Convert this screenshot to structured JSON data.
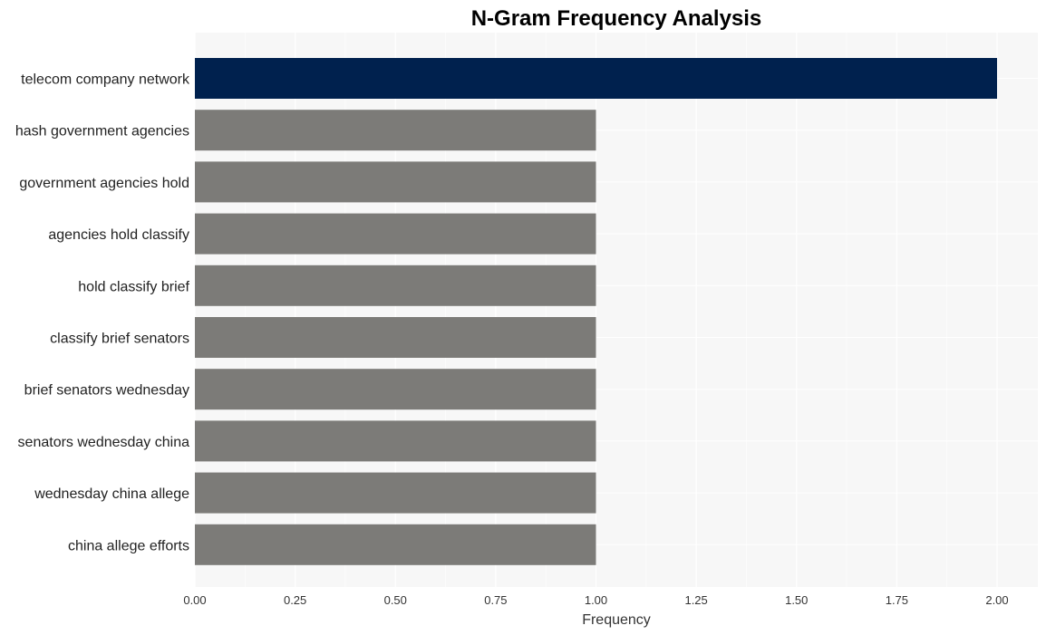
{
  "chart_data": {
    "type": "bar",
    "orientation": "horizontal",
    "title": "N-Gram Frequency Analysis",
    "xlabel": "Frequency",
    "ylabel": "",
    "xlim": [
      0,
      2.1
    ],
    "xticks": [
      0,
      0.25,
      0.5,
      0.75,
      1.0,
      1.25,
      1.5,
      1.75,
      2.0
    ],
    "xtick_labels": [
      "0.00",
      "0.25",
      "0.50",
      "0.75",
      "1.00",
      "1.25",
      "1.50",
      "1.75",
      "2.00"
    ],
    "grid": true,
    "categories": [
      "telecom company network",
      "hash government agencies",
      "government agencies hold",
      "agencies hold classify",
      "hold classify brief",
      "classify brief senators",
      "brief senators wednesday",
      "senators wednesday china",
      "wednesday china allege",
      "china allege efforts"
    ],
    "values": [
      2,
      1,
      1,
      1,
      1,
      1,
      1,
      1,
      1,
      1
    ],
    "colors": {
      "highlight": "#00214e",
      "default": "#7c7b78",
      "plot_background": "#f7f7f7",
      "grid": "#ffffff"
    }
  }
}
